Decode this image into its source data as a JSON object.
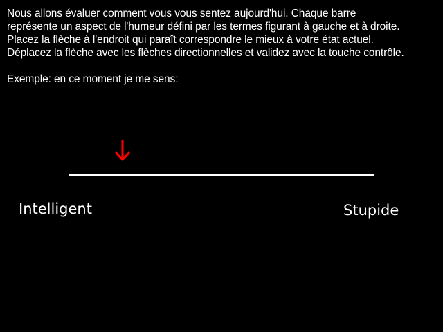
{
  "instructions": {
    "lines": [
      "Nous allons évaluer comment vous vous sentez aujourd'hui. Chaque barre",
      "représente un aspect de l'humeur défini par les termes figurant à gauche et à droite.",
      "Placez la flèche à l'endroit qui paraît correspondre le mieux à votre état actuel.",
      "Déplacez la flèche avec les flèches directionnelles et validez avec la touche contrôle."
    ],
    "example": "Exemple: en ce moment je me sens:"
  },
  "scale": {
    "left_label": "Intelligent",
    "right_label": "Stupide",
    "marker_icon": "arrow-down-icon",
    "marker_fraction": 0.17,
    "colors": {
      "background": "#000000",
      "bar": "#ffffff",
      "marker": "#ff0000",
      "text": "#ffffff"
    }
  }
}
